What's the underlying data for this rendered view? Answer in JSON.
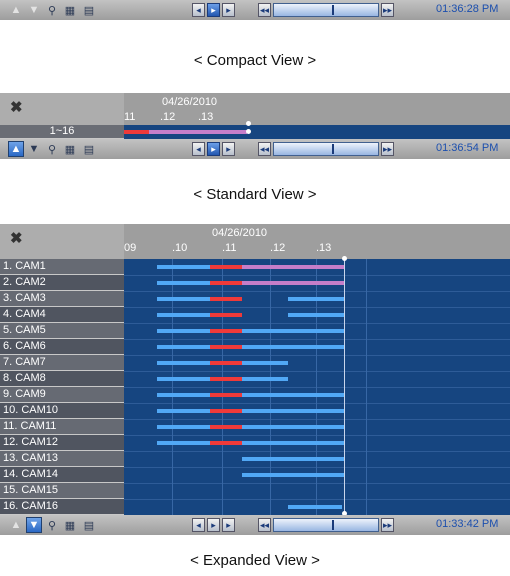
{
  "colors": {
    "blue": "#51a8f5",
    "red": "#ee3a3a",
    "pink": "#c57ec9"
  },
  "compact": {
    "caption": "< Compact View >",
    "toolbar": {
      "time": "01:36:28 PM"
    }
  },
  "standard": {
    "caption": "< Standard View >",
    "date": "04/26/2010",
    "ticks": [
      "11",
      ".12",
      ".13"
    ],
    "range_label": "1~16",
    "toolbar": {
      "time": "01:36:54 PM"
    }
  },
  "expanded": {
    "caption": "< Expanded View >",
    "date": "04/26/2010",
    "ticks": [
      "09",
      ".10",
      ".11",
      ".12",
      ".13"
    ],
    "cameras": [
      "1. CAM1",
      "2. CAM2",
      "3. CAM3",
      "4. CAM4",
      "5. CAM5",
      "6. CAM6",
      "7. CAM7",
      "8. CAM8",
      "9. CAM9",
      "10. CAM10",
      "11. CAM11",
      "12. CAM12",
      "13. CAM13",
      "14. CAM14",
      "15. CAM15",
      "16. CAM16"
    ],
    "toolbar": {
      "time": "01:33:42 PM"
    }
  },
  "icons": {
    "up": "triangle-up-icon",
    "down": "triangle-down-icon",
    "zoom": "zoom-icon",
    "calendar": "calendar-icon",
    "export": "export-icon",
    "prev": "previous-frame-icon",
    "play": "play-icon",
    "next": "next-frame-icon",
    "rewind": "fast-rewind-icon",
    "forward": "fast-forward-icon"
  }
}
